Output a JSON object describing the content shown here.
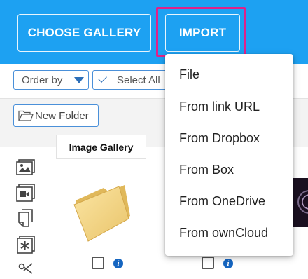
{
  "header": {
    "choose_gallery_label": "CHOOSE GALLERY",
    "import_label": "IMPORT",
    "accent_color": "#1da1f2",
    "highlight_color": "#e0218a"
  },
  "toolbar": {
    "order_by_label": "Order by",
    "select_all_label": "Select All"
  },
  "folder_bar": {
    "new_folder_label": "New Folder"
  },
  "gallery": {
    "tab_label": "Image Gallery",
    "side_icons": [
      "image-icon",
      "video-icon",
      "document-icon",
      "asterisk-icon",
      "scissors-icon"
    ]
  },
  "import_menu": {
    "items": [
      "File",
      "From link URL",
      "From Dropbox",
      "From Box",
      "From OneDrive",
      "From ownCloud"
    ]
  }
}
